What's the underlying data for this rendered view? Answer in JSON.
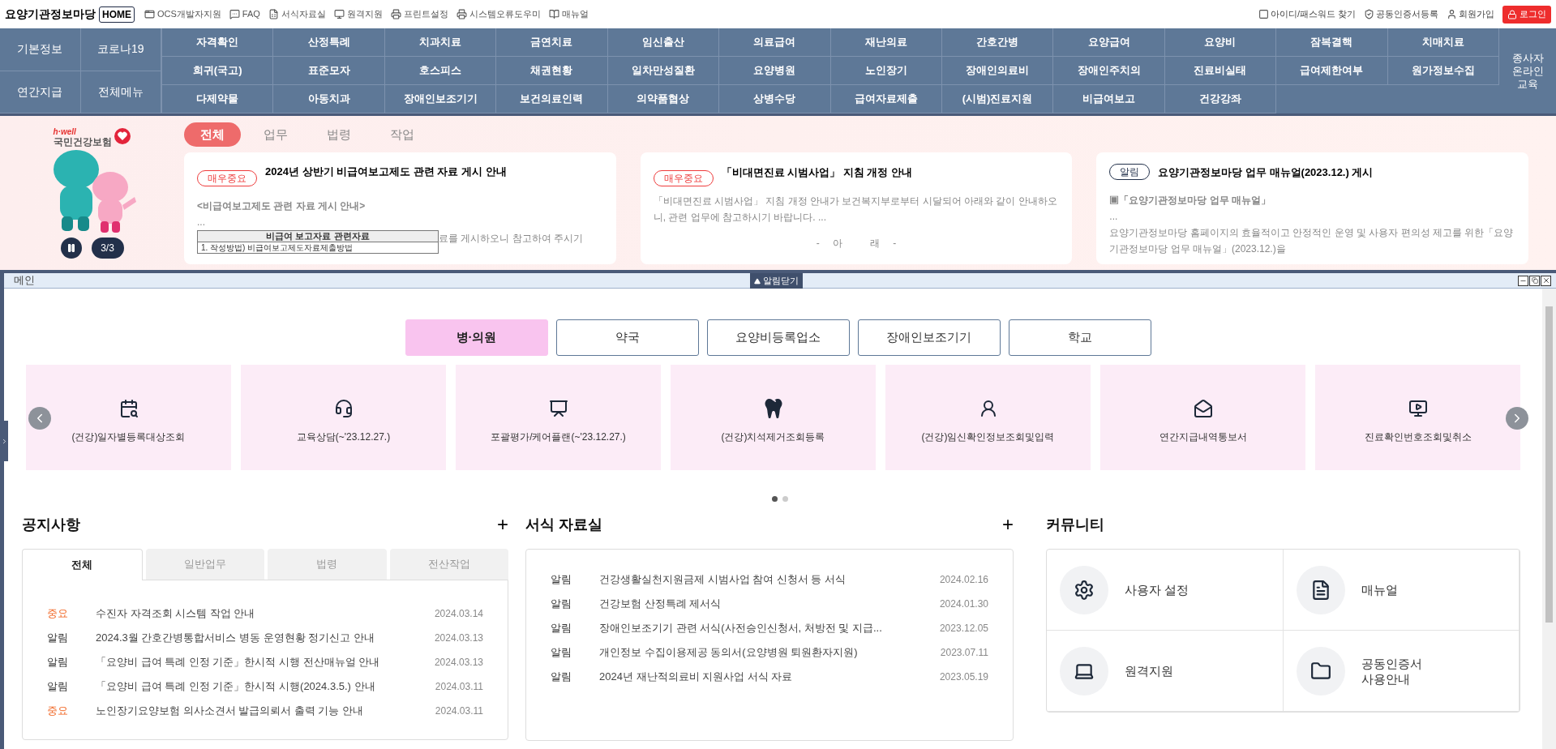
{
  "header": {
    "site_title": "요양기관정보마당",
    "home_button": "HOME",
    "links": [
      {
        "label": "OCS개발자지원",
        "kind": "window"
      },
      {
        "label": "FAQ",
        "kind": "chat"
      },
      {
        "label": "서식자료실",
        "kind": "form"
      },
      {
        "label": "원격지원",
        "kind": "monitor"
      },
      {
        "label": "프린트설정",
        "kind": "printer"
      },
      {
        "label": "시스템오류도우미",
        "kind": "printer"
      },
      {
        "label": "매뉴얼",
        "kind": "book"
      }
    ],
    "account_links": [
      {
        "label": "아이디/패스워드 찾기",
        "kind": "square"
      },
      {
        "label": "공동인증서등록",
        "kind": "shield"
      },
      {
        "label": "회원가입",
        "kind": "user"
      }
    ],
    "login_button": "로그인"
  },
  "nav": {
    "side_items": [
      "기본정보",
      "코로나19",
      "연간지급",
      "전체메뉴"
    ],
    "menu_rows": [
      [
        "자격확인",
        "산정특례",
        "치과치료",
        "금연치료",
        "임신출산",
        "의료급여",
        "재난의료",
        "간호간병",
        "요양급여",
        "요양비",
        "잠복결핵",
        "치매치료"
      ],
      [
        "희귀(국고)",
        "표준모자",
        "호스피스",
        "채권현황",
        "일차만성질환",
        "요양병원",
        "노인장기",
        "장애인의료비",
        "장애인주치의",
        "진료비실태",
        "급여제한여부",
        "원가정보수집"
      ],
      [
        "다제약물",
        "아동치과",
        "장애인보조기기",
        "보건의료인력",
        "의약품협상",
        "상병수당",
        "급여자료제출",
        "(시범)진료지원",
        "비급여보고",
        "건강강좌"
      ]
    ],
    "side_right": "종사자 온라인 교육"
  },
  "notice_banner": {
    "logo_small": "h·well",
    "logo": "국민건강보험",
    "page_indicator": "3/3",
    "tabs": [
      {
        "label": "전체",
        "selected": true
      },
      {
        "label": "업무",
        "selected": false
      },
      {
        "label": "법령",
        "selected": false
      },
      {
        "label": "작업",
        "selected": false
      }
    ],
    "cards": [
      {
        "badge": "매우중요",
        "kind": "urgent",
        "title": "2024년 상반기 비급여보고제도 관련 자료 게시 안내",
        "paragraphs": [
          {
            "kind": "strong",
            "text": "<비급여보고제도 관련 자료 게시 안내>"
          },
          {
            "kind": "text",
            "text": "..."
          },
          {
            "kind": "document",
            "title": "비급여 보고자료 관련자료",
            "caption": "1. 작성방법) 비급여보고제도자료제출방법",
            "text": "료를 게시하오니 참고하여 주시기"
          }
        ]
      },
      {
        "badge": "매우중요",
        "kind": "urgent",
        "title": "「비대면진료 시범사업」 지침 개정 안내",
        "paragraphs": [
          {
            "kind": "text",
            "text": "「비대면진료 시범사업」 지침 개정 안내가 보건복지부로부터 시달되어 아래와 같이 안내하오니, 관련 업무에 참고하시기 바랍니다. ..."
          },
          {
            "kind": "center",
            "text": "-     아          래     -"
          }
        ]
      },
      {
        "badge": "알림",
        "kind": "notice",
        "title": "요양기관정보마당 업무 매뉴얼(2023.12.) 게시",
        "paragraphs": [
          {
            "kind": "strong",
            "text": "▣「요양기관정보마당 업무 매뉴얼」"
          },
          {
            "kind": "text",
            "text": "..."
          },
          {
            "kind": "text",
            "text": "요양기관정보마당 홈페이지의 효율적이고 안정적인 운영 및 사용자 편의성 제고를 위한「요양기관정보마당 업무 매뉴얼」(2023.12.)을"
          }
        ]
      }
    ]
  },
  "window": {
    "title": "메인",
    "close_alerts_button": "알림닫기"
  },
  "categories": [
    {
      "label": "병·의원",
      "selected": true
    },
    {
      "label": "약국",
      "selected": false
    },
    {
      "label": "요양비등록업소",
      "selected": false
    },
    {
      "label": "장애인보조기기",
      "selected": false
    },
    {
      "label": "학교",
      "selected": false
    }
  ],
  "services": [
    {
      "label": "(건강)일자별등록대상조회",
      "kind": "calendar"
    },
    {
      "label": "교육상담(~'23.12.27.)",
      "kind": "headset"
    },
    {
      "label": "포괄평가/케어플랜(~'23.12.27.)",
      "kind": "board"
    },
    {
      "label": "(건강)치석제거조회등록",
      "kind": "tooth"
    },
    {
      "label": "(건강)임신확인정보조회및입력",
      "kind": "person"
    },
    {
      "label": "연간지급내역통보서",
      "kind": "mail"
    },
    {
      "label": "진료확인번호조회및취소",
      "kind": "monitor"
    }
  ],
  "carousel_dots": [
    {
      "selected": true
    },
    {
      "selected": false
    }
  ],
  "notices": {
    "title": "공지사항",
    "more_button": "+",
    "tabs": [
      {
        "label": "전체",
        "selected": true
      },
      {
        "label": "일반업무",
        "selected": false
      },
      {
        "label": "법령",
        "selected": false
      },
      {
        "label": "전산작업",
        "selected": false
      }
    ],
    "rows": [
      {
        "tag": "중요",
        "important": true,
        "title": "수진자 자격조회 시스템 작업 안내",
        "date": "2024.03.14"
      },
      {
        "tag": "알림",
        "important": false,
        "title": "2024.3월 간호간병통합서비스 병동 운영현황 정기신고 안내",
        "date": "2024.03.13"
      },
      {
        "tag": "알림",
        "important": false,
        "title": "「요양비 급여 특례 인정 기준」한시적 시행 전산매뉴얼 안내",
        "date": "2024.03.13"
      },
      {
        "tag": "알림",
        "important": false,
        "title": "「요양비 급여 특례 인정 기준」한시적 시행(2024.3.5.) 안내",
        "date": "2024.03.11"
      },
      {
        "tag": "중요",
        "important": true,
        "title": "노인장기요양보험 의사소견서 발급의뢰서 출력 기능 안내",
        "date": "2024.03.11"
      }
    ]
  },
  "forms": {
    "title": "서식 자료실",
    "more_button": "+",
    "rows": [
      {
        "tag": "알림",
        "title": "건강생활실천지원금제 시범사업 참여 신청서 등 서식",
        "date": "2024.02.16"
      },
      {
        "tag": "알림",
        "title": "건강보험 산정특례 제서식",
        "date": "2024.01.30"
      },
      {
        "tag": "알림",
        "title": "장애인보조기기 관련 서식(사전승인신청서, 처방전 및 지급...",
        "date": "2023.12.05"
      },
      {
        "tag": "알림",
        "title": "개인정보 수집이용제공 동의서(요양병원 퇴원환자지원)",
        "date": "2023.07.11"
      },
      {
        "tag": "알림",
        "title": "2024년 재난적의료비 지원사업 서식 자료",
        "date": "2023.05.19"
      }
    ]
  },
  "community": {
    "title": "커뮤니티",
    "items": [
      {
        "label": "사용자 설정",
        "kind": "gear"
      },
      {
        "label": "매뉴얼",
        "kind": "document"
      },
      {
        "label": "원격지원",
        "kind": "laptop"
      },
      {
        "label": "공동인증서\n사용안내",
        "kind": "folder"
      }
    ]
  }
}
